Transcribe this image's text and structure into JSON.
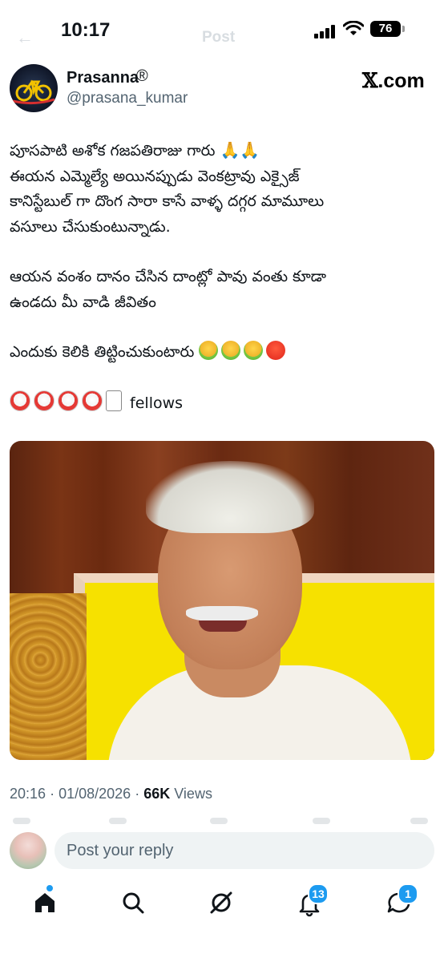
{
  "status_bar": {
    "time": "10:17",
    "battery": "76"
  },
  "nav": {
    "ghost_title": "Post"
  },
  "author": {
    "display_name": "Prasanna",
    "verified_mark": "®",
    "handle": "@prasana_kumar"
  },
  "brand": {
    "text": ".com",
    "x_glyph": "𝕏"
  },
  "tweet": {
    "lines": [
      "పూసపాటి అశోక గజపతిరాజు గారు",
      "ఈయన ఎమ్మెల్యే అయినప్పుడు వెంకట్రావు ఎక్సైజ్",
      "కానిస్టేబుల్ గా దొంగ సారా కాసే వాళ్ళ దగ్గర మామూలు",
      "వసూలు చేసుకుంటున్నాడు.",
      "ఆయన వంశం దానం చేసిన దాంట్లో పావు వంతు కూడా",
      "ఉండదు మీ వాడి జీవితం",
      "ఎందుకు కెలికి తిట్టించుకుంటారు",
      "fellows"
    ],
    "emoji": {
      "pray": "pray-emoji",
      "vomit": "vomit-emoji",
      "angry": "angry-emoji",
      "clown": "clown-emoji",
      "card": "joker-card-emoji"
    }
  },
  "photo": {
    "subject": "photo of an elderly man with white hair and mustache"
  },
  "meta": {
    "time": "20:16",
    "date": "01/08/2026",
    "views_count": "66K",
    "views_label": "Views",
    "sep": "·"
  },
  "reply": {
    "placeholder": "Post your reply"
  },
  "tabbar": {
    "notifications_badge": "13",
    "messages_badge": "1"
  },
  "colors": {
    "accent": "#1d9bf0",
    "text": "#0f1419",
    "secondary": "#536471"
  }
}
